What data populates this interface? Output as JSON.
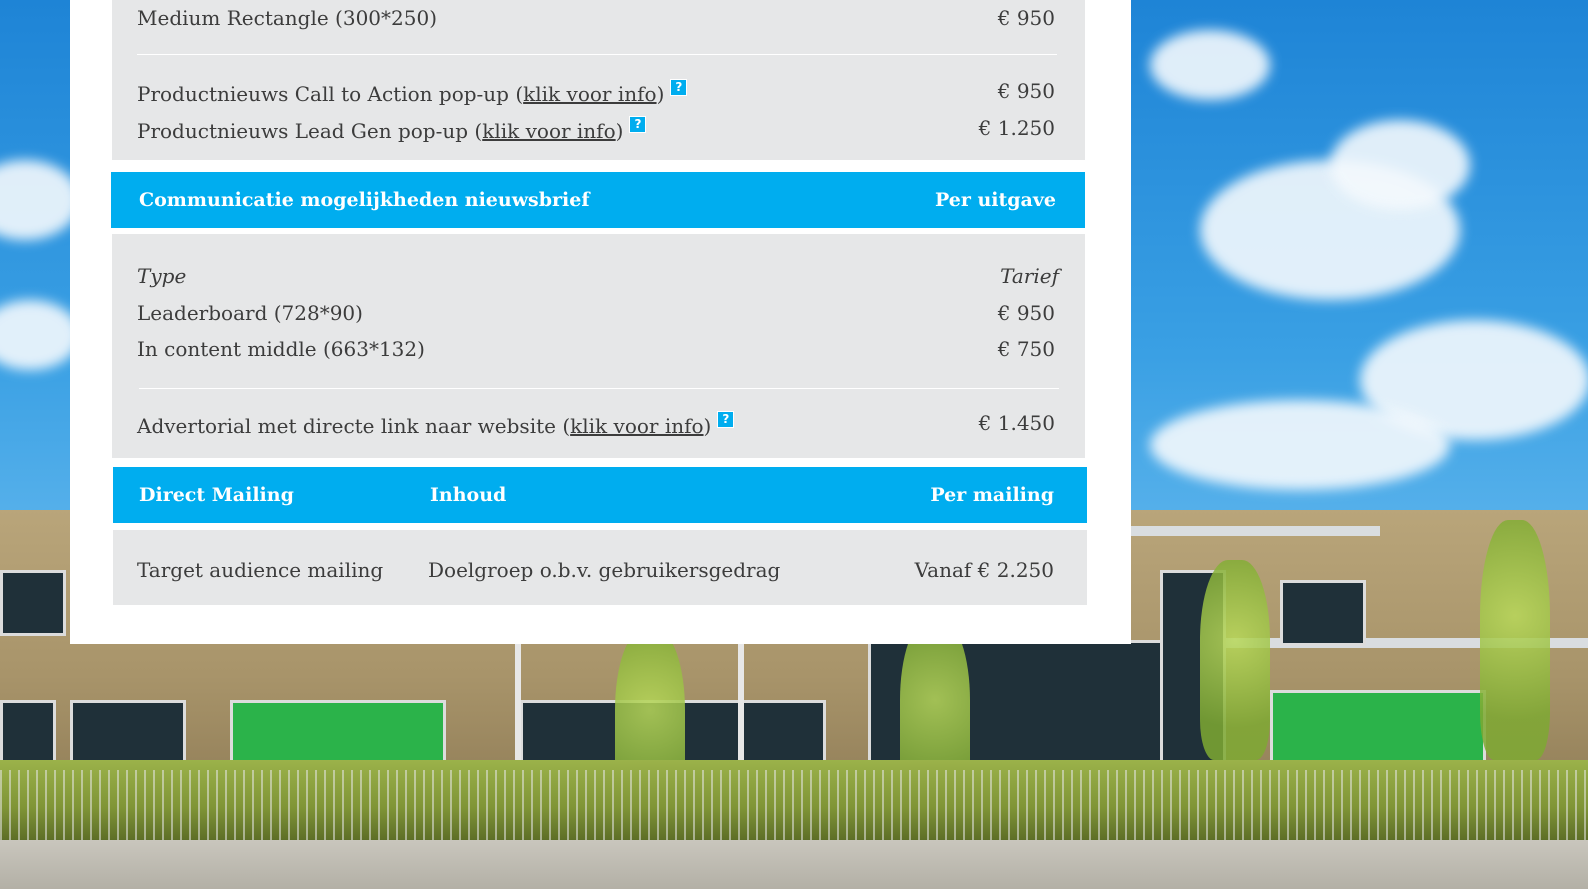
{
  "banner": {
    "rows": [
      {
        "label": "Medium Rectangle (300*250)",
        "price": "€ 950"
      }
    ],
    "popups": [
      {
        "label_pre": "Productnieuws Call to Action pop-up (",
        "link": "klik voor info",
        "label_post": ")",
        "price": "€ 950"
      },
      {
        "label_pre": "Productnieuws Lead Gen pop-up (",
        "link": "klik voor info",
        "label_post": ")",
        "price": "€ 1.250"
      }
    ]
  },
  "newsletter": {
    "header_left": "Communicatie mogelijkheden nieuwsbrief",
    "header_right": "Per uitgave",
    "col_type": "Type",
    "col_rate": "Tarief",
    "rows": [
      {
        "label": "Leaderboard (728*90)",
        "price": "€ 950"
      },
      {
        "label": "In content middle (663*132)",
        "price": "€ 750"
      }
    ],
    "advertorial": {
      "label_pre": "Advertorial met directe link naar website (",
      "link": "klik voor info",
      "label_post": ")",
      "price": "€ 1.450"
    }
  },
  "direct_mailing": {
    "header_col1": "Direct Mailing",
    "header_col2": "Inhoud",
    "header_col3": "Per mailing",
    "row": {
      "name": "Target audience mailing",
      "content": "Doelgroep o.b.v. gebruikersgedrag",
      "price": "Vanaf € 2.250"
    }
  },
  "icons": {
    "help": "?"
  },
  "colors": {
    "accent": "#00adef",
    "block": "#e6e7e8",
    "text": "#3c3c3c"
  }
}
